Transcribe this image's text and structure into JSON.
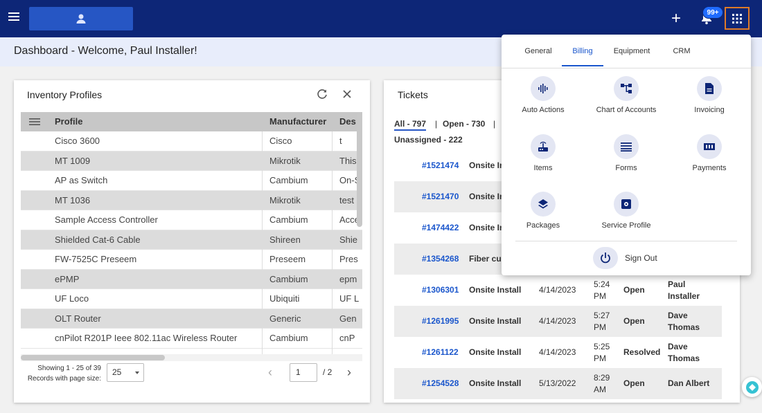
{
  "topbar": {
    "notification_badge": "99+",
    "accent_color": "#0d2677"
  },
  "header": {
    "title": "Dashboard - Welcome, Paul Installer!"
  },
  "inventory": {
    "title": "Inventory Profiles",
    "columns": [
      "Profile",
      "Manufacturer",
      "Des"
    ],
    "rows": [
      [
        "Cisco 3600",
        "Cisco",
        "t"
      ],
      [
        "MT 1009",
        "Mikrotik",
        "This"
      ],
      [
        "AP as Switch",
        "Cambium",
        "On-S"
      ],
      [
        "MT 1036",
        "Mikrotik",
        "test"
      ],
      [
        "Sample Access Controller",
        "Cambium",
        "Acce"
      ],
      [
        "Shielded Cat-6 Cable",
        "Shireen",
        "Shie"
      ],
      [
        "FW-7525C Preseem",
        "Preseem",
        "Pres"
      ],
      [
        "ePMP",
        "Cambium",
        "epm"
      ],
      [
        "UF Loco",
        "Ubiquiti",
        "UF L"
      ],
      [
        "OLT Router",
        "Generic",
        "Gen"
      ],
      [
        "cnPilot R201P Ieee 802.11ac Wireless Router",
        "Cambium",
        "cnP"
      ]
    ],
    "pager": {
      "showing": "Showing 1 - 25 of 39",
      "records_label": "Records with page size:",
      "page_size": "25",
      "current_page": "1",
      "total_pages": "/ 2"
    }
  },
  "tickets": {
    "title": "Tickets",
    "filters": {
      "all": "All - 797",
      "sep": "|",
      "open": "Open - 730",
      "sep2": "|",
      "unassigned": "Unassigned - 222"
    },
    "rows": [
      {
        "id": "#1521474",
        "type": "Onsite In",
        "date": "",
        "time": "",
        "status": "",
        "assignee": ""
      },
      {
        "id": "#1521470",
        "type": "Onsite In",
        "date": "",
        "time": "",
        "status": "",
        "assignee": ""
      },
      {
        "id": "#1474422",
        "type": "Onsite In",
        "date": "",
        "time": "",
        "status": "",
        "assignee": ""
      },
      {
        "id": "#1354268",
        "type": "Fiber cu",
        "date": "",
        "time": "",
        "status": "",
        "assignee": ""
      },
      {
        "id": "#1306301",
        "type": "Onsite Install",
        "date": "4/14/2023",
        "time": "5:24 PM",
        "status": "Open",
        "assignee": "Paul Installer"
      },
      {
        "id": "#1261995",
        "type": "Onsite Install",
        "date": "4/14/2023",
        "time": "5:27 PM",
        "status": "Open",
        "assignee": "Dave Thomas"
      },
      {
        "id": "#1261122",
        "type": "Onsite Install",
        "date": "4/14/2023",
        "time": "5:25 PM",
        "status": "Resolved",
        "assignee": "Dave Thomas"
      },
      {
        "id": "#1254528",
        "type": "Onsite Install",
        "date": "5/13/2022",
        "time": "8:29 AM",
        "status": "Open",
        "assignee": "Dan Albert"
      }
    ]
  },
  "menu": {
    "tabs": [
      "General",
      "Billing",
      "Equipment",
      "CRM"
    ],
    "active_tab": "Billing",
    "items": [
      {
        "label": "Auto Actions",
        "icon": "waveform-icon"
      },
      {
        "label": "Chart of Accounts",
        "icon": "hierarchy-icon"
      },
      {
        "label": "Invoicing",
        "icon": "document-icon"
      },
      {
        "label": "Items",
        "icon": "router-icon"
      },
      {
        "label": "Forms",
        "icon": "list-icon"
      },
      {
        "label": "Payments",
        "icon": "money-icon"
      },
      {
        "label": "Packages",
        "icon": "layers-icon"
      },
      {
        "label": "Service Profile",
        "icon": "settings-icon"
      }
    ],
    "sign_out": "Sign Out"
  }
}
